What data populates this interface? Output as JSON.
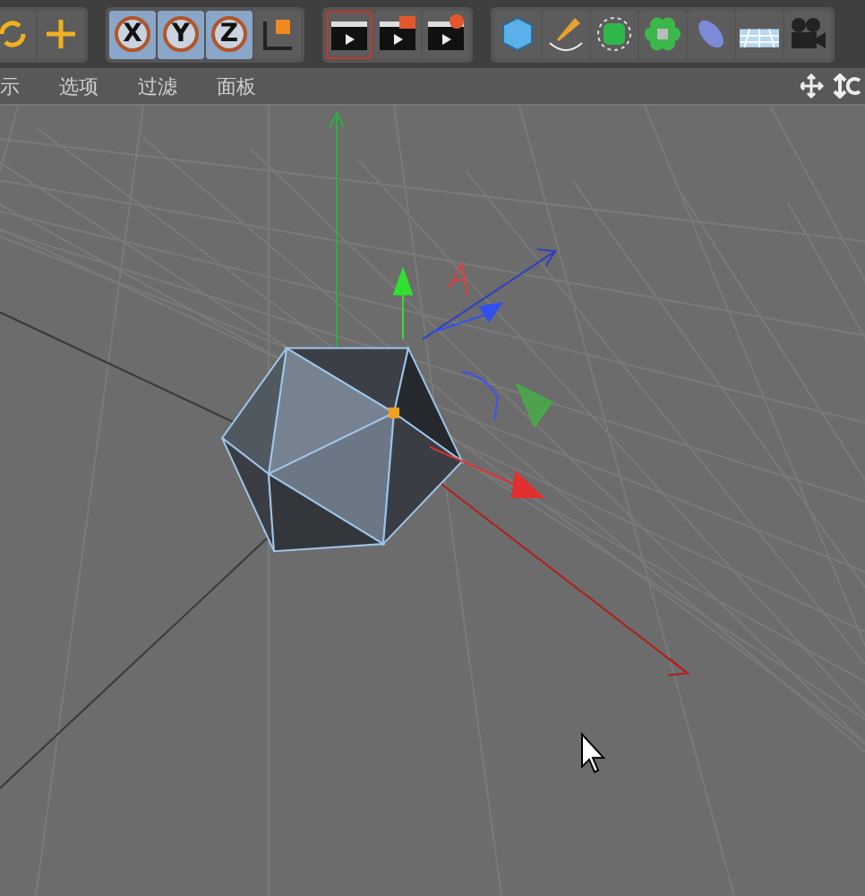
{
  "toolbar": {
    "groups": [
      [
        {
          "kind": "icon",
          "selected": false
        },
        {
          "kind": "icon",
          "selected": false
        }
      ],
      [
        {
          "kind": "axis",
          "label": "X",
          "selected": true
        },
        {
          "kind": "axis",
          "label": "Y",
          "selected": true
        },
        {
          "kind": "axis",
          "label": "Z",
          "selected": true
        },
        {
          "kind": "icon",
          "selected": false
        }
      ],
      [
        {
          "kind": "icon",
          "selected": true
        },
        {
          "kind": "icon",
          "selected": false
        },
        {
          "kind": "icon",
          "selected": false
        }
      ],
      [
        {
          "kind": "icon",
          "selected": false
        },
        {
          "kind": "icon",
          "selected": false
        },
        {
          "kind": "icon",
          "selected": false
        },
        {
          "kind": "icon",
          "selected": false
        },
        {
          "kind": "icon",
          "selected": false
        },
        {
          "kind": "icon",
          "selected": false
        },
        {
          "kind": "icon",
          "selected": false
        }
      ]
    ]
  },
  "menu": [
    "示",
    "选项",
    "过滤",
    "面板"
  ]
}
